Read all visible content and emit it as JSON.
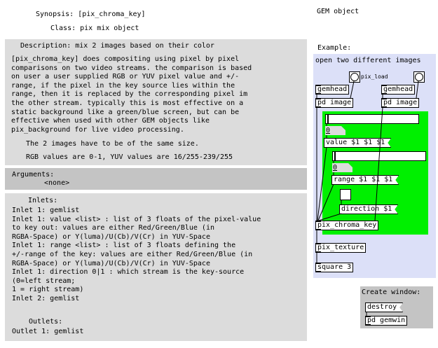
{
  "header": {
    "synopsis": "Synopsis: [pix_chroma_key]",
    "class": "Class: pix mix object",
    "category": "GEM object"
  },
  "description": {
    "title": "Description: mix 2 images based on their color",
    "lines": [
      "[pix_chroma_key] does compositing using pixel by pixel",
      "comparisons on two video streams. the comparison is based",
      "on user a user supplied RGB or YUV pixel value and +/-",
      "range, if the pixel in the key source lies within the",
      "range, then it is replaced by the corresponding pixel im",
      "the other stream. typically this is most effective on a",
      "static background like a green/blue screen, but can be",
      "effective when used with other GEM objects like",
      "pix_background for live video processing."
    ],
    "note1": "The 2 images have to be of the same size.",
    "note2": "RGB values are 0-1, YUV values are 16/255-239/255"
  },
  "arguments": {
    "title": "Arguments:",
    "value": "<none>"
  },
  "inlets": {
    "title": "Inlets:",
    "lines": [
      "Inlet 1: gemlist",
      "Inlet 1: value <list> : list of 3 floats of the pixel-value",
      "to key out: values are either Red/Green/Blue (in",
      "RGBA-Space) or Y(luma)/U(Cb)/V(Cr) in YUV-Space",
      "Inlet 1: range <list> : list of 3 floats defining the",
      "+/-range of the key: values are either Red/Green/Blue (in",
      "RGBA-Space) or Y(luma)/U(Cb)/V(Cr) in YUV-Space",
      "Inlet 1: direction 0|1 : which stream is the key-source",
      "(0=left stream;",
      "1 = right stream)",
      "Inlet 2: gemlist"
    ]
  },
  "outlets": {
    "title": "Outlets:",
    "line": "Outlet 1: gemlist"
  },
  "example": {
    "title": "Example:",
    "comment": "open two different images",
    "pix_load_label": "pix_load",
    "gemhead_left": "gemhead",
    "gemhead_right": "gemhead",
    "pix_image_left": "pd image",
    "pix_image_right": "pd image",
    "num_value": "0",
    "value_msg": "value $1 $1 $1",
    "num_range": "0",
    "range_msg": "range $1 $1 $1",
    "direction_msg": "direction $1",
    "chroma_key": "pix_chroma_key",
    "pix_texture": "pix_texture",
    "square": "square 3"
  },
  "window": {
    "title": "Create window:",
    "destroy": "destroy",
    "gemwin": "pd gemwin"
  },
  "colors": {
    "panel": "#dcdcdc",
    "panel_dark": "#c4c4c4",
    "example_bg": "#dce0f8",
    "green": "#00f000"
  }
}
